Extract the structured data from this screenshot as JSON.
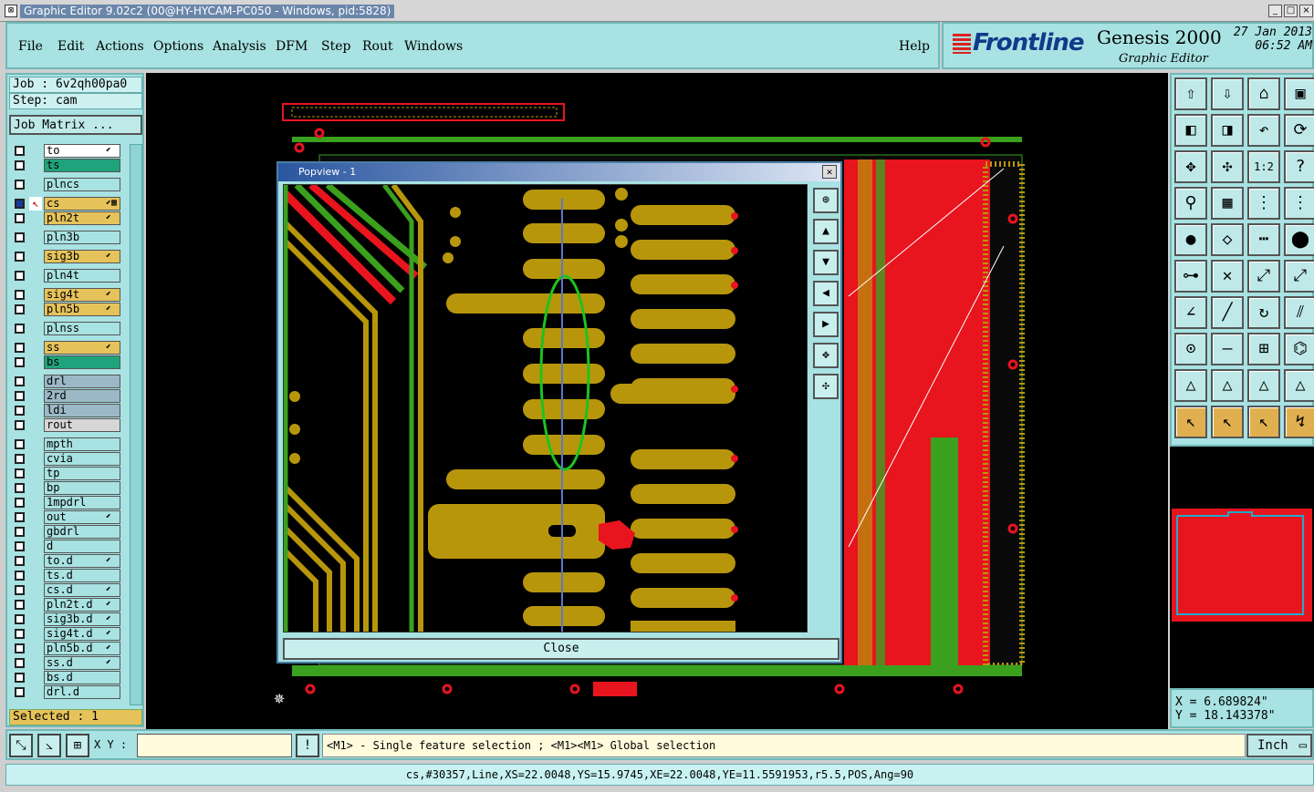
{
  "window": {
    "title": "Graphic Editor 9.02c2 (00@HY-HYCAM-PC050 - Windows, pid:5828)",
    "min": "_",
    "max": "□",
    "close": "×"
  },
  "menu": {
    "items": [
      "File",
      "Edit",
      "Actions",
      "Options",
      "Analysis",
      "DFM",
      "Step",
      "Rout",
      "Windows"
    ],
    "help": "Help"
  },
  "brand": {
    "logo": "Frontline",
    "product": "Genesis 2000",
    "subtitle": "Graphic Editor",
    "date": "27 Jan 2013",
    "time": "06:52 AM"
  },
  "job": {
    "job_label": "Job : 6v2qh00pa0",
    "step_label": "Step: cam",
    "matrix_button": "Job Matrix ..."
  },
  "layers": [
    {
      "name": "to",
      "color": "#ffffff",
      "arrow": "⬋"
    },
    {
      "name": "ts",
      "color": "#1fa37c",
      "arrow": ""
    },
    {
      "name": "plncs",
      "color": "#a8e2e2",
      "arrow": ""
    },
    {
      "name": "cs",
      "color": "#e6c35a",
      "arrow": "⬋▦",
      "active": true
    },
    {
      "name": "pln2t",
      "color": "#e6c35a",
      "arrow": "⬋"
    },
    {
      "name": "pln3b",
      "color": "#a8e2e2",
      "arrow": ""
    },
    {
      "name": "sig3b",
      "color": "#e6c35a",
      "arrow": "⬋"
    },
    {
      "name": "pln4t",
      "color": "#a8e2e2",
      "arrow": ""
    },
    {
      "name": "sig4t",
      "color": "#e6c35a",
      "arrow": "⬋"
    },
    {
      "name": "pln5b",
      "color": "#e6c35a",
      "arrow": "⬋"
    },
    {
      "name": "plnss",
      "color": "#a8e2e2",
      "arrow": ""
    },
    {
      "name": "ss",
      "color": "#e6c35a",
      "arrow": "⬋"
    },
    {
      "name": "bs",
      "color": "#1fa37c",
      "arrow": ""
    },
    {
      "name": "drl",
      "color": "#9cb8c6",
      "arrow": ""
    },
    {
      "name": "2rd",
      "color": "#9cb8c6",
      "arrow": ""
    },
    {
      "name": "ldi",
      "color": "#9cb8c6",
      "arrow": ""
    },
    {
      "name": "rout",
      "color": "#d6d6d6",
      "arrow": ""
    },
    {
      "name": "mpth",
      "color": "#a8e2e2",
      "arrow": ""
    },
    {
      "name": "cvia",
      "color": "#a8e2e2",
      "arrow": ""
    },
    {
      "name": "tp",
      "color": "#a8e2e2",
      "arrow": ""
    },
    {
      "name": "bp",
      "color": "#a8e2e2",
      "arrow": ""
    },
    {
      "name": "1mpdrl",
      "color": "#a8e2e2",
      "arrow": ""
    },
    {
      "name": "out",
      "color": "#a8e2e2",
      "arrow": "⬋"
    },
    {
      "name": "gbdrl",
      "color": "#a8e2e2",
      "arrow": ""
    },
    {
      "name": "d",
      "color": "#a8e2e2",
      "arrow": ""
    },
    {
      "name": "to.d",
      "color": "#a8e2e2",
      "arrow": "⬋"
    },
    {
      "name": "ts.d",
      "color": "#a8e2e2",
      "arrow": ""
    },
    {
      "name": "cs.d",
      "color": "#a8e2e2",
      "arrow": "⬋"
    },
    {
      "name": "pln2t.d",
      "color": "#a8e2e2",
      "arrow": "⬋"
    },
    {
      "name": "sig3b.d",
      "color": "#a8e2e2",
      "arrow": "⬋"
    },
    {
      "name": "sig4t.d",
      "color": "#a8e2e2",
      "arrow": "⬋"
    },
    {
      "name": "pln5b.d",
      "color": "#a8e2e2",
      "arrow": "⬋"
    },
    {
      "name": "ss.d",
      "color": "#a8e2e2",
      "arrow": "⬋"
    },
    {
      "name": "bs.d",
      "color": "#a8e2e2",
      "arrow": ""
    },
    {
      "name": "drl.d",
      "color": "#a8e2e2",
      "arrow": ""
    }
  ],
  "selected": "Selected : 1",
  "popup": {
    "title": "Popview - 1",
    "close_label": "Close"
  },
  "tool_icons": [
    "zoom-home",
    "zoom-fit-icon",
    "zoom-prev-icon",
    "layout-icon",
    "pan-left-icon",
    "pan-right-icon",
    "undo-zoom-icon",
    "redraw-icon",
    "fit-all-icon",
    "center-icon",
    "scale-1-2-icon",
    "help-icon",
    "snap-icon",
    "grid-icon",
    "layers-a-icon",
    "layers-b-icon",
    "pad-icon",
    "polygon-icon",
    "measure-icon",
    "circle-icon",
    "net-icon",
    "cross-icon",
    "line-node-icon",
    "arc-node-icon",
    "angle-icon",
    "diag-icon",
    "rotate-icon",
    "mirror-icon",
    "drill-icon",
    "dash-icon",
    "step-repeat-icon",
    "connect-icon",
    "triangle-a-icon",
    "triangle-b-icon",
    "triangle-c-icon",
    "triangle-d-icon",
    "pointer-a-icon",
    "pointer-b-icon",
    "pointer-c-icon",
    "pointer-d-icon"
  ],
  "coords": {
    "x": "X = 6.689824\"",
    "y": "Y = 18.143378\""
  },
  "bottom": {
    "xy_label": "X Y :",
    "xy_value": "",
    "message": "<M1> - Single feature selection ; <M1><M1> Global selection",
    "units": "Inch"
  },
  "status": "cs,#30357,Line,XS=22.0048,YS=15.9745,XE=22.0048,YE=11.5591953,r5.5,POS,Ang=90",
  "colors": {
    "panel": "#a8e2e2",
    "copper": "#b8960c",
    "red": "#e8141e",
    "green": "#3aa01e",
    "active_layer": "#e6c35a"
  }
}
